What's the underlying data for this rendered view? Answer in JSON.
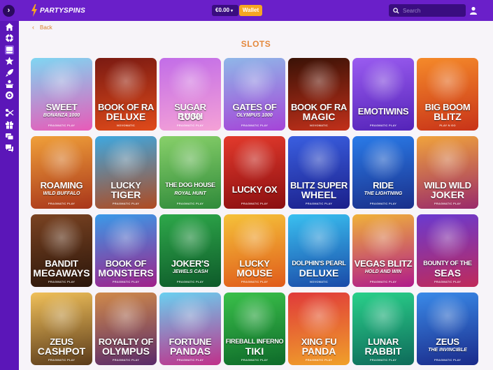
{
  "header": {
    "brand": "PARTYSPINS",
    "balance": "€0.00",
    "wallet_label": "Wallet",
    "search_placeholder": "Search"
  },
  "sidebar": {
    "items": [
      {
        "icon": "home-icon"
      },
      {
        "icon": "casino-chip-icon"
      },
      {
        "icon": "slots-icon"
      },
      {
        "icon": "star-icon"
      },
      {
        "icon": "rocket-icon"
      },
      {
        "icon": "live-casino-icon"
      },
      {
        "icon": "bingo-icon"
      },
      {
        "icon": "promotions-icon"
      },
      {
        "icon": "gift-icon"
      },
      {
        "icon": "vip-icon"
      },
      {
        "icon": "chat-icon"
      }
    ]
  },
  "page": {
    "back_label": "Back",
    "title": "SLOTS"
  },
  "games": [
    {
      "name": "SWEET",
      "sub": "BONANZA 1000",
      "provider": "PRAGMATIC PLAY",
      "colors": [
        "#7fd6f2",
        "#e85ab8"
      ]
    },
    {
      "name": "BOOK OF RA",
      "sub": "DELUXE",
      "provider": "NOVOMATIC",
      "colors": [
        "#7a1a12",
        "#e04a1a"
      ]
    },
    {
      "name": "SUGAR RUSH",
      "sub": "1000",
      "provider": "PRAGMATIC PLAY",
      "colors": [
        "#c26de8",
        "#f5a1d6"
      ]
    },
    {
      "name": "GATES OF",
      "sub": "OLYMPUS 1000",
      "provider": "PRAGMATIC PLAY",
      "colors": [
        "#8fb7e8",
        "#a544d8"
      ]
    },
    {
      "name": "BOOK OF RA",
      "sub": "MAGIC",
      "provider": "NOVOMATIC",
      "colors": [
        "#3a1206",
        "#c2301a"
      ]
    },
    {
      "name": "EMOTIWINS",
      "sub": "",
      "provider": "PRAGMATIC PLAY",
      "colors": [
        "#9a5cf0",
        "#5423b8"
      ]
    },
    {
      "name": "BIG BOOM",
      "sub": "BLITZ",
      "provider": "PLAY N GO",
      "colors": [
        "#f58a2a",
        "#c83318"
      ]
    },
    {
      "name": "ROAMING",
      "sub": "WILD BUFFALO",
      "provider": "PRAGMATIC PLAY",
      "colors": [
        "#f0a03a",
        "#a8351a"
      ]
    },
    {
      "name": "LUCKY",
      "sub": "TIGER",
      "provider": "PRAGMATIC PLAY",
      "colors": [
        "#3ea8e0",
        "#b04a20"
      ]
    },
    {
      "name": "THE DOG HOUSE",
      "sub": "ROYAL HUNT",
      "provider": "PRAGMATIC PLAY",
      "colors": [
        "#88d06a",
        "#2f8a3a"
      ]
    },
    {
      "name": "LUCKY OX",
      "sub": "",
      "provider": "PRAGMATIC PLAY",
      "colors": [
        "#e33a2c",
        "#8a0e10"
      ]
    },
    {
      "name": "BLITZ SUPER",
      "sub": "WHEEL",
      "provider": "PRAGMATIC PLAY",
      "colors": [
        "#3a5fe0",
        "#1b1f8a"
      ]
    },
    {
      "name": "RIDE",
      "sub": "THE LIGHTNING",
      "provider": "PRAGMATIC PLAY",
      "colors": [
        "#2a7be8",
        "#1a2f8a"
      ]
    },
    {
      "name": "WILD WILD",
      "sub": "JOKER",
      "provider": "PRAGMATIC PLAY",
      "colors": [
        "#f0a33c",
        "#9a2a6a"
      ]
    },
    {
      "name": "BANDIT",
      "sub": "MEGAWAYS",
      "provider": "PRAGMATIC PLAY",
      "colors": [
        "#7a4322",
        "#2a150a"
      ]
    },
    {
      "name": "BOOK OF",
      "sub": "MONSTERS",
      "provider": "PRAGMATIC PLAY",
      "colors": [
        "#3a9ae8",
        "#a0208a"
      ]
    },
    {
      "name": "JOKER'S",
      "sub": "JEWELS CASH",
      "provider": "PRAGMATIC PLAY",
      "colors": [
        "#2ea84a",
        "#0e5a2a"
      ]
    },
    {
      "name": "LUCKY",
      "sub": "MOUSE",
      "provider": "PRAGMATIC PLAY",
      "colors": [
        "#f5c23a",
        "#e05a1a"
      ]
    },
    {
      "name": "DOLPHIN'S PEARL",
      "sub": "DELUXE",
      "provider": "NOVOMATIC",
      "colors": [
        "#3ac0f0",
        "#1a4aa8"
      ]
    },
    {
      "name": "VEGAS BLITZ",
      "sub": "HOLD AND WIN",
      "provider": "PRAGMATIC PLAY",
      "colors": [
        "#f0b23a",
        "#b01a8a"
      ]
    },
    {
      "name": "BOUNTY OF THE",
      "sub": "SEAS",
      "provider": "PRAGMATIC PLAY",
      "colors": [
        "#6a3ad0",
        "#c02a5a"
      ]
    },
    {
      "name": "ZEUS",
      "sub": "CASHPOT",
      "provider": "PRAGMATIC PLAY",
      "colors": [
        "#f0c05a",
        "#5a3a1a"
      ]
    },
    {
      "name": "ROYALTY OF",
      "sub": "OLYMPUS",
      "provider": "PRAGMATIC PLAY",
      "colors": [
        "#d08a4a",
        "#5a2a6a"
      ]
    },
    {
      "name": "FORTUNE",
      "sub": "PANDAS",
      "provider": "PRAGMATIC PLAY",
      "colors": [
        "#6ad0f0",
        "#c0308a"
      ]
    },
    {
      "name": "FIREBALL INFERNO",
      "sub": "TIKI",
      "provider": "PRAGMATIC PLAY",
      "colors": [
        "#3ac04a",
        "#0e6a2a"
      ]
    },
    {
      "name": "XING FU",
      "sub": "PANDA",
      "provider": "PRAGMATIC PLAY",
      "colors": [
        "#e03a3a",
        "#f0a02a"
      ]
    },
    {
      "name": "LUNAR",
      "sub": "RABBIT",
      "provider": "PRAGMATIC PLAY",
      "colors": [
        "#2ad08a",
        "#0e6a5a"
      ]
    },
    {
      "name": "ZEUS",
      "sub": "THE INVINCIBLE",
      "provider": "PRAGMATIC PLAY",
      "colors": [
        "#3a8ae8",
        "#1a2a8a"
      ]
    }
  ]
}
